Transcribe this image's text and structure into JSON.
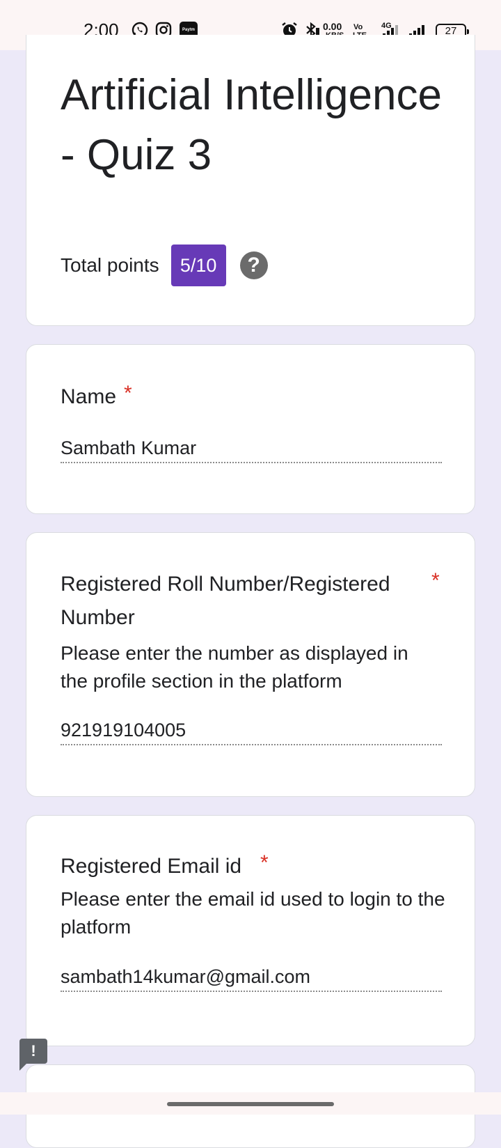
{
  "status_bar": {
    "time": "2:00",
    "speed_value": "0.00",
    "speed_unit": "KB/S",
    "volte_top": "Vo",
    "volte_bottom": "LTE",
    "network": "4G",
    "battery": "27",
    "icons": [
      "whatsapp-icon",
      "instagram-icon",
      "paytm-icon",
      "alarm-icon",
      "bluetooth-icon",
      "signal-icon"
    ],
    "paytm_label": "Paytm"
  },
  "form": {
    "title": "Artificial Intelligence - Quiz 3",
    "points_label": "Total points",
    "points_value": "5/10",
    "help_symbol": "?",
    "accent_color": "#673ab7"
  },
  "questions": [
    {
      "label": "Name",
      "required_marker": "*",
      "description": "",
      "answer": "Sambath Kumar"
    },
    {
      "label": "Registered Roll Number/Registered Number",
      "required_marker": "*",
      "description": "Please enter the number as displayed in the profile section in the platform",
      "answer": "921919104005"
    },
    {
      "label": "Registered Email id",
      "required_marker": "*",
      "description": "Please enter the email id used to login to the platform",
      "answer": "sambath14kumar@gmail.com"
    }
  ],
  "feedback_symbol": "!"
}
